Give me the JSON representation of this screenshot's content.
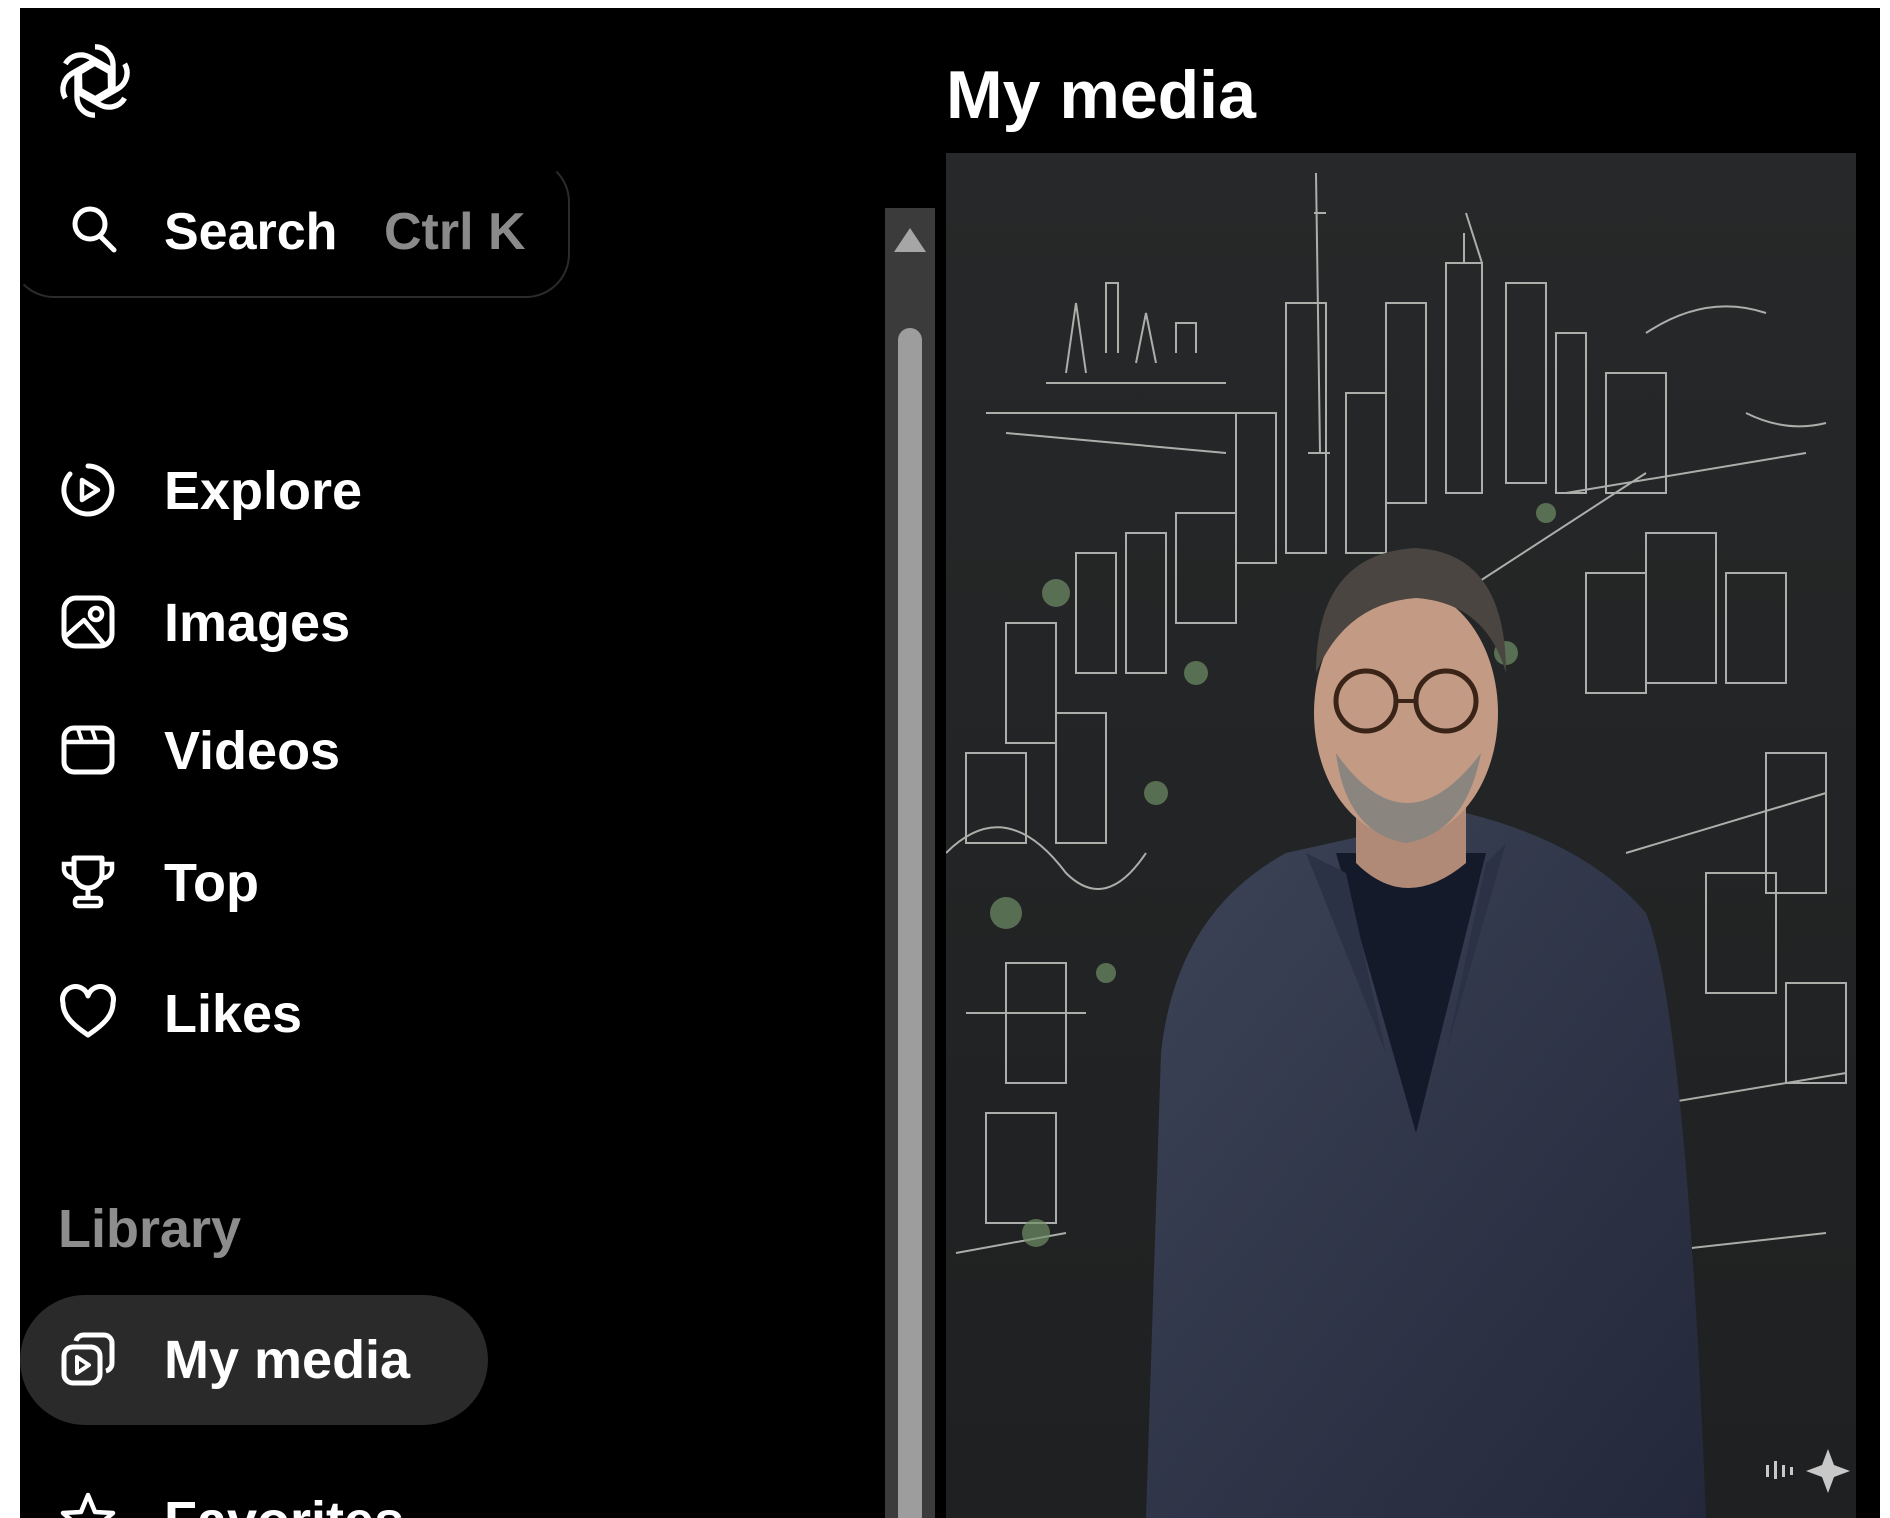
{
  "app": {
    "logo": "openai-logo-icon"
  },
  "search": {
    "label": "Search",
    "shortcut": "Ctrl K",
    "icon": "search-icon"
  },
  "nav": {
    "items": [
      {
        "label": "Explore",
        "icon": "play-circle-icon"
      },
      {
        "label": "Images",
        "icon": "image-icon"
      },
      {
        "label": "Videos",
        "icon": "video-icon"
      },
      {
        "label": "Top",
        "icon": "trophy-icon"
      },
      {
        "label": "Likes",
        "icon": "heart-icon"
      }
    ]
  },
  "library": {
    "title": "Library",
    "items": [
      {
        "label": "My media",
        "icon": "media-stack-icon",
        "active": true
      },
      {
        "label": "Favorites",
        "icon": "star-icon"
      }
    ]
  },
  "main": {
    "title": "My media",
    "media": [
      {
        "type": "image",
        "watermark": "sparkle-icon"
      }
    ]
  },
  "colors": {
    "background": "#000000",
    "active_item": "#2a2a2a",
    "muted_text": "#8d8d8d",
    "scroll_track": "#3b3b3b"
  }
}
